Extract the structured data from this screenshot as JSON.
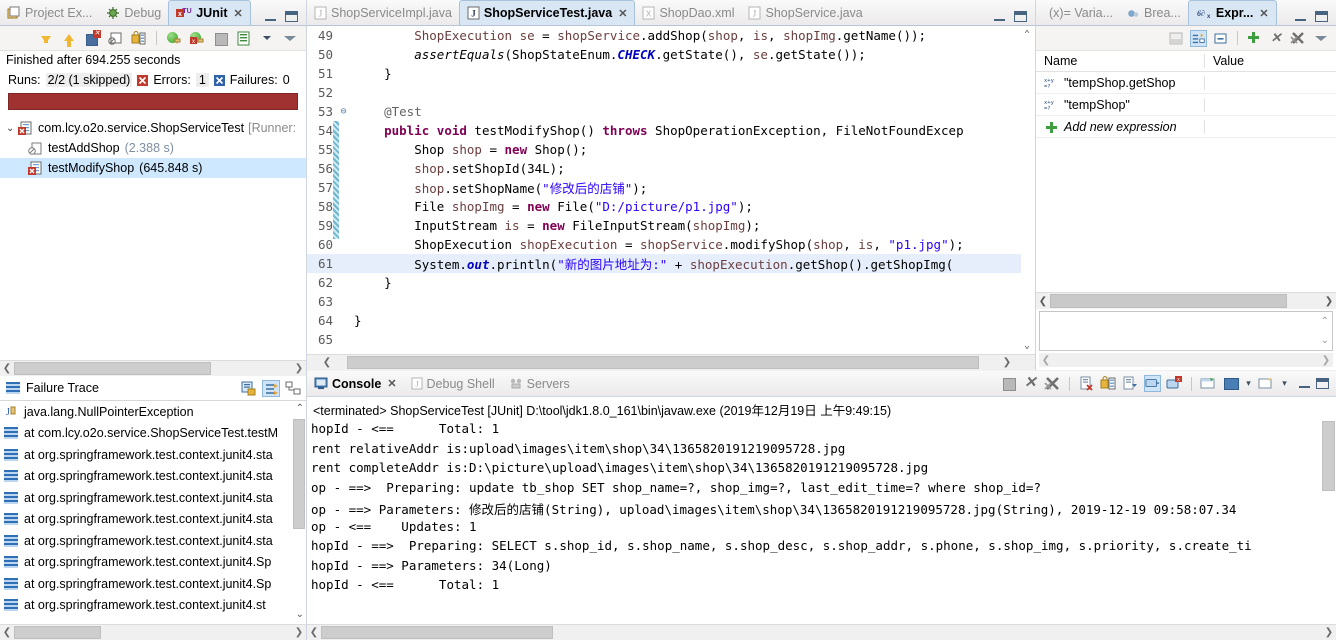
{
  "junit": {
    "tabs": [
      {
        "label": "Project Ex...",
        "icon": "project-explorer-icon",
        "active": false
      },
      {
        "label": "Debug",
        "icon": "debug-icon",
        "active": false
      },
      {
        "label": "JUnit",
        "icon": "junit-icon",
        "active": true
      }
    ],
    "close_glyph": "✕",
    "toolbar_icons": [
      "next-failure-icon",
      "prev-failure-icon",
      "show-failures-only-icon",
      "filter-stack-trace-icon",
      "lock-scroll-icon",
      "rerun-test-icon",
      "rerun-failed-icon",
      "stop-icon",
      "test-run-history-icon",
      "view-menu-arrow-icon",
      "view-minimize-arrow-icon"
    ],
    "status": "Finished after 694.255 seconds",
    "counts": {
      "runs_label": "Runs:",
      "runs_value": "2/2 (1 skipped)",
      "errors_label": "Errors:",
      "errors_value": "1",
      "failures_label": "Failures:",
      "failures_value": "0"
    },
    "progress_color": "#a03232",
    "tree": [
      {
        "label": "com.lcy.o2o.service.ShopServiceTest",
        "suffix": "[Runner:",
        "icon": "test-class-error-icon",
        "expanded": true,
        "selected": false,
        "child": false
      },
      {
        "label": "testAddShop",
        "time": "(2.388 s)",
        "icon": "test-skipped-icon",
        "selected": false,
        "child": true
      },
      {
        "label": "testModifyShop",
        "time": "(645.848 s)",
        "icon": "test-error-icon",
        "selected": true,
        "child": true
      }
    ]
  },
  "failure_trace": {
    "title": "Failure Trace",
    "title_icon": "stack-lines-icon",
    "tools": [
      "copy-trace-icon",
      "filter-stack-trace-icon",
      "compare-result-icon"
    ],
    "rows": [
      {
        "text": "java.lang.NullPointerException",
        "icon": "exception-icon"
      },
      {
        "text": "at com.lcy.o2o.service.ShopServiceTest.testM",
        "icon": "stack-frame-icon"
      },
      {
        "text": "at org.springframework.test.context.junit4.sta",
        "icon": "stack-frame-icon"
      },
      {
        "text": "at org.springframework.test.context.junit4.sta",
        "icon": "stack-frame-icon"
      },
      {
        "text": "at org.springframework.test.context.junit4.sta",
        "icon": "stack-frame-icon"
      },
      {
        "text": "at org.springframework.test.context.junit4.sta",
        "icon": "stack-frame-icon"
      },
      {
        "text": "at org.springframework.test.context.junit4.sta",
        "icon": "stack-frame-icon"
      },
      {
        "text": "at org.springframework.test.context.junit4.Sp",
        "icon": "stack-frame-icon"
      },
      {
        "text": "at org.springframework.test.context.junit4.Sp",
        "icon": "stack-frame-icon"
      },
      {
        "text": "at org.springframework.test.context.junit4.st",
        "icon": "stack-frame-icon"
      }
    ]
  },
  "editor": {
    "tabs": [
      {
        "label": "ShopServiceImpl.java",
        "icon": "java-file-icon",
        "active": false
      },
      {
        "label": "ShopServiceTest.java",
        "icon": "java-file-icon",
        "active": true
      },
      {
        "label": "ShopDao.xml",
        "icon": "xml-file-icon",
        "active": false
      },
      {
        "label": "ShopService.java",
        "icon": "java-file-icon",
        "active": false
      }
    ],
    "close_glyph": "✕",
    "lines": [
      {
        "no": "49",
        "fold": "",
        "hl": false,
        "html": "        <span class='loc'>ShopExecution</span> <span class='loc'>se</span> = <span class='loc'>shopService</span>.addShop(<span class='loc'>shop</span>, <span class='loc'>is</span>, <span class='loc'>shopImg</span>.getName());"
      },
      {
        "no": "50",
        "fold": "",
        "hl": false,
        "html": "        <span class='ital'>assertEquals</span>(ShopStateEnum.<span class='stat'>CHECK</span>.getState(), <span class='loc'>se</span>.getState());"
      },
      {
        "no": "51",
        "fold": "",
        "hl": false,
        "html": "    }"
      },
      {
        "no": "52",
        "fold": "",
        "hl": false,
        "html": ""
      },
      {
        "no": "53",
        "fold": "⊖",
        "hl": false,
        "html": "    <span class='anno'>@Test</span>"
      },
      {
        "no": "54",
        "fold": "",
        "hl": false,
        "html": "    <span class='kw'>public</span> <span class='kw'>void</span> testModifyShop() <span class='kw'>throws</span> ShopOperationException, FileNotFoundExcep"
      },
      {
        "no": "55",
        "fold": "",
        "hl": false,
        "html": "        Shop <span class='loc'>shop</span> = <span class='kw'>new</span> Shop();"
      },
      {
        "no": "56",
        "fold": "",
        "hl": false,
        "html": "        <span class='loc'>shop</span>.setShopId(34L);"
      },
      {
        "no": "57",
        "fold": "",
        "hl": false,
        "html": "        <span class='loc'>shop</span>.setShopName(<span class='str'>\"修改后的店铺\"</span>);"
      },
      {
        "no": "58",
        "fold": "",
        "hl": false,
        "html": "        File <span class='loc'>shopImg</span> = <span class='kw'>new</span> File(<span class='str'>\"D:/picture/p1.jpg\"</span>);"
      },
      {
        "no": "59",
        "fold": "",
        "hl": false,
        "html": "        InputStream <span class='loc'>is</span> = <span class='kw'>new</span> FileInputStream(<span class='loc'>shopImg</span>);"
      },
      {
        "no": "60",
        "fold": "",
        "hl": false,
        "html": "        ShopExecution <span class='loc'>shopExecution</span> = <span class='loc'>shopService</span>.modifyShop(<span class='loc'>shop</span>, <span class='loc'>is</span>, <span class='str'>\"p1.jpg\"</span>);"
      },
      {
        "no": "61",
        "fold": "",
        "hl": true,
        "html": "        System.<span class='fld ital'><b>out</b></span>.println(<span class='str'>\"新的图片地址为:\"</span> + <span class='loc'>shopExecution</span>.getShop().getShopImg("
      },
      {
        "no": "62",
        "fold": "",
        "hl": false,
        "html": "    }"
      },
      {
        "no": "63",
        "fold": "",
        "hl": false,
        "html": ""
      },
      {
        "no": "64",
        "fold": "",
        "hl": false,
        "html": "}"
      },
      {
        "no": "65",
        "fold": "",
        "hl": false,
        "html": ""
      }
    ]
  },
  "expressions": {
    "tabs": [
      {
        "label": "(x)= Varia...",
        "icon": "variables-icon",
        "active": false
      },
      {
        "label": "Brea...",
        "icon": "breakpoints-icon",
        "active": false
      },
      {
        "label": "Expr...",
        "icon": "expressions-icon",
        "active": true
      }
    ],
    "close_glyph": "✕",
    "toolbar_icons": [
      "show-logical-structure-icon",
      "collapse-all-icon",
      "remove-selected-icon",
      "add-expression-icon",
      "remove-expression-icon",
      "remove-all-expressions-icon",
      "view-menu-arrow-icon"
    ],
    "columns": [
      "Name",
      "Value"
    ],
    "rows": [
      {
        "name": "\"tempShop.getShop",
        "value": "",
        "icon": "expression-icon"
      },
      {
        "name": "\"tempShop\"",
        "value": "",
        "icon": "expression-icon"
      },
      {
        "name": "Add new expression",
        "value": "",
        "icon": "add-new-expression-icon",
        "italic": true
      }
    ]
  },
  "console": {
    "tabs": [
      {
        "label": "Console",
        "icon": "console-icon",
        "active": true
      },
      {
        "label": "Debug Shell",
        "icon": "debug-shell-icon",
        "active": false
      },
      {
        "label": "Servers",
        "icon": "servers-icon",
        "active": false
      }
    ],
    "close_glyph": "✕",
    "toolbar_icons": [
      "terminate-icon",
      "remove-launch-icon",
      "remove-all-terminated-icon",
      "clear-console-icon",
      "scroll-lock-icon",
      "show-console-on-output-icon",
      "pin-console-icon",
      "display-selected-console-icon",
      "new-console-view-icon",
      "open-console-icon",
      "view-menu-icon",
      "minimize-icon",
      "maximize-icon"
    ],
    "terminated_line": "<terminated> ShopServiceTest [JUnit] D:\\tool\\jdk1.8.0_161\\bin\\javaw.exe (2019年12月19日 上午9:49:15)",
    "lines": [
      "hopId - <==      Total: 1",
      "rent relativeAddr is:upload\\images\\item\\shop\\34\\1365820191219095728.jpg",
      "rent completeAddr is:D:\\picture\\upload\\images\\item\\shop\\34\\1365820191219095728.jpg",
      "op - ==>  Preparing: update tb_shop SET shop_name=?, shop_img=?, last_edit_time=? where shop_id=?",
      "op - ==> Parameters: 修改后的店铺(String), upload\\images\\item\\shop\\34\\1365820191219095728.jpg(String), 2019-12-19 09:58:07.34",
      "op - <==    Updates: 1",
      "hopId - ==>  Preparing: SELECT s.shop_id, s.shop_name, s.shop_desc, s.shop_addr, s.phone, s.shop_img, s.priority, s.create_ti",
      "hopId - ==> Parameters: 34(Long)",
      "hopId - <==      Total: 1"
    ]
  }
}
